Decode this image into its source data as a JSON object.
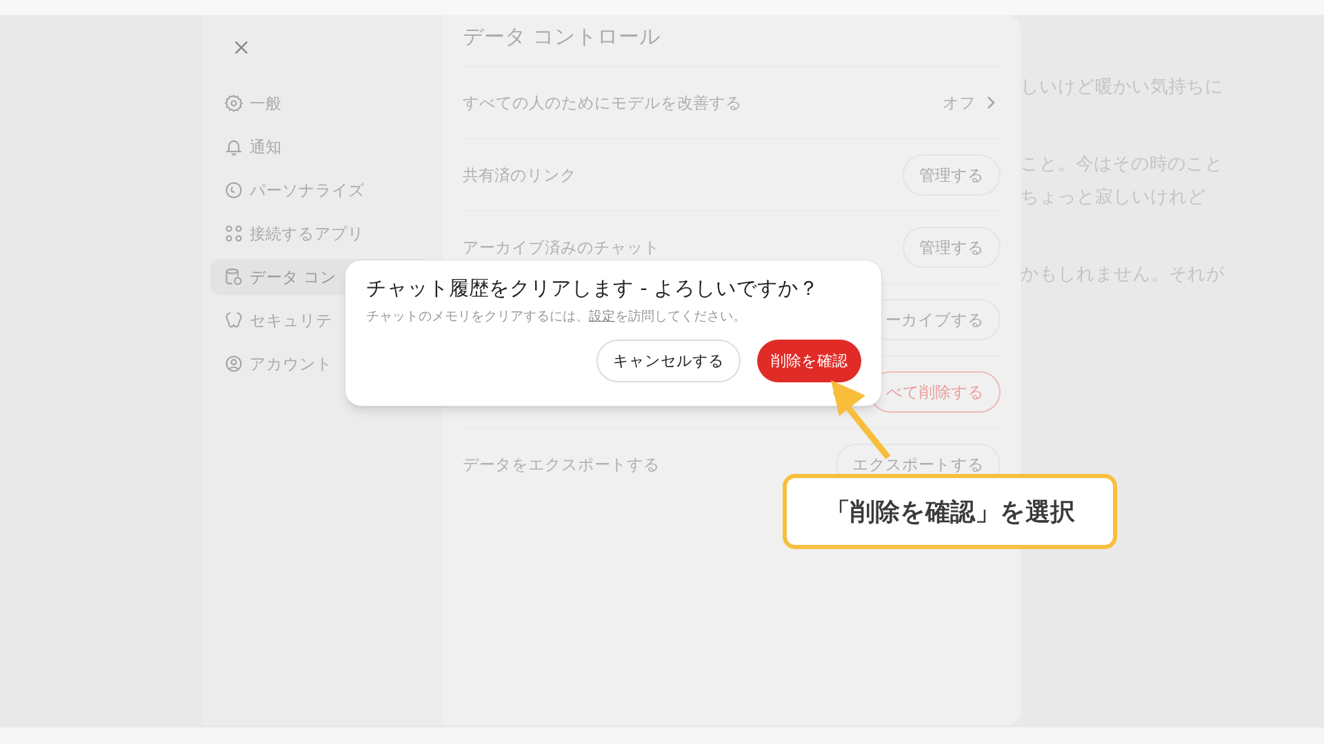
{
  "settings": {
    "sidebar": {
      "items": [
        {
          "label": "一般",
          "selected": false
        },
        {
          "label": "通知",
          "selected": false
        },
        {
          "label": "パーソナライズ",
          "selected": false
        },
        {
          "label": "接続するアプリ",
          "selected": false
        },
        {
          "label": "データ コン",
          "selected": true
        },
        {
          "label": "セキュリテ",
          "selected": false
        },
        {
          "label": "アカウント",
          "selected": false
        }
      ]
    },
    "content": {
      "title": "データ コントロール",
      "rows": [
        {
          "kind": "value",
          "label": "すべての人のためにモデルを改善する",
          "value": "オフ"
        },
        {
          "kind": "button",
          "label": "共有済のリンク",
          "button": "管理する"
        },
        {
          "kind": "button",
          "label": "アーカイブ済みのチャット",
          "button": "管理する"
        },
        {
          "kind": "button",
          "button": "ーカイブする"
        },
        {
          "kind": "danger",
          "button": "べて削除する"
        },
        {
          "kind": "button",
          "label": "データをエクスポートする",
          "button": "エクスポートする"
        }
      ]
    }
  },
  "background_text": {
    "paragraphs": [
      [
        "しいけど暖かい気持ちに"
      ],
      [
        "こと。今はその時のこと",
        "ちょっと寂しいけれど"
      ],
      [
        "かもしれません。それが"
      ]
    ]
  },
  "dialog": {
    "title": "チャット履歴をクリアします - よろしいですか？",
    "message_before": "チャットのメモリをクリアするには、",
    "message_link": "設定",
    "message_after": "を訪問してください。",
    "buttons": [
      {
        "kind": "secondary",
        "label": "キャンセルする"
      },
      {
        "kind": "danger",
        "label": "削除を確認"
      }
    ]
  },
  "callout": {
    "text": "「削除を確認」を選択"
  }
}
